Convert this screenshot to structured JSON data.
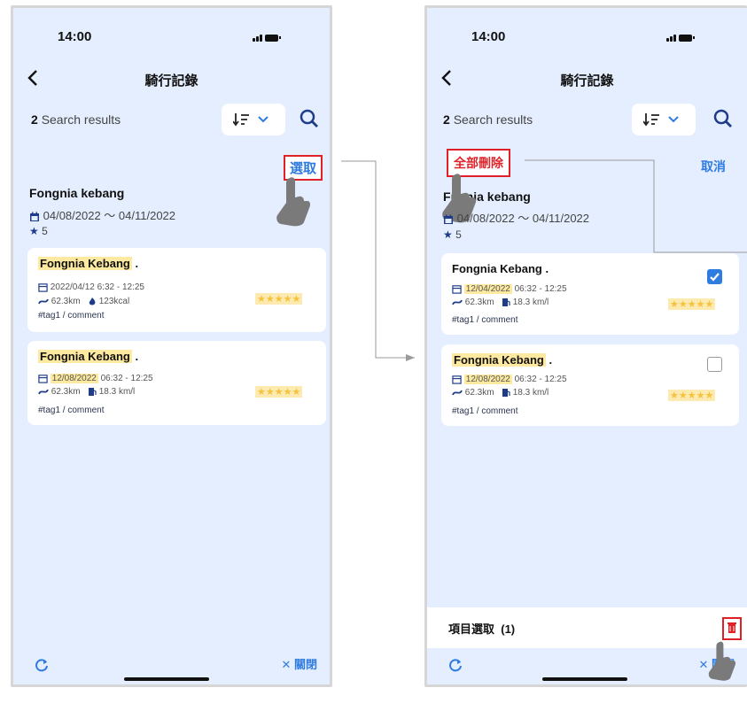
{
  "status": {
    "time": "14:00"
  },
  "header": {
    "title": "騎行記錄"
  },
  "results": {
    "count": "2",
    "label": "Search results"
  },
  "actions": {
    "select": "選取",
    "delete_all": "全部刪除",
    "cancel": "取消"
  },
  "left": {
    "group": {
      "name": "Fongnia kebang",
      "date_range": "04/08/2022 ～ 04/11/2022",
      "rating": "5"
    },
    "cards": [
      {
        "name": "Fongnia Kebang",
        "dot": ".",
        "date": "2022/04/12",
        "time": " 6:32 - 12:25",
        "distance": "62.3km",
        "metric": "123kcal",
        "tags": "#tag1 / comment",
        "stars": "★★★★★"
      },
      {
        "name": "Fongnia Kebang",
        "dot": ".",
        "date": "12/08/2022",
        "time": " 06:32 - 12:25",
        "distance": "62.3km",
        "metric": "18.3 km/l",
        "tags": "#tag1 / comment",
        "stars": "★★★★★"
      }
    ]
  },
  "right": {
    "group": {
      "name": "ngnia kebang",
      "name_prefix": "F",
      "date_range": "04/08/2022 ～ 04/11/2022",
      "rating": "5"
    },
    "cards": [
      {
        "name": "Fongnia Kebang",
        "dot": ".",
        "date": "12/04/2022",
        "time": " 06:32 - 12:25",
        "distance": "62.3km",
        "metric": "18.3 km/l",
        "tags": "#tag1 / comment",
        "stars": "★★★★★",
        "checked": true
      },
      {
        "name": "Fongnia Kebang",
        "dot": ".",
        "date": "12/08/2022",
        "time": " 06:32 - 12:25",
        "distance": "62.3km",
        "metric": "18.3 km/l",
        "tags": "#tag1 / comment",
        "stars": "★★★★★",
        "checked": false
      }
    ],
    "selection": {
      "label": "項目選取",
      "count": "(1)"
    }
  },
  "footer": {
    "close_label": "關閉",
    "close_glyph": "✕"
  },
  "colors": {
    "accent": "#2f7ce0",
    "highlight_red": "#e02027",
    "screen_bg": "#e5eeff",
    "star": "#f6c23e"
  },
  "icons": [
    "back-arrow-icon",
    "sort-icon",
    "chevron-down-icon",
    "search-icon",
    "calendar-icon",
    "star-icon",
    "route-icon",
    "flame-icon",
    "fuel-icon",
    "checkbox-icon",
    "trash-icon",
    "refresh-icon",
    "close-icon",
    "hand-pointer-icon"
  ]
}
